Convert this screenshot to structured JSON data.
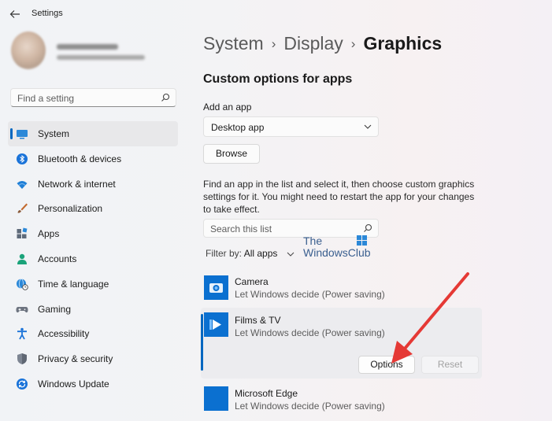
{
  "window": {
    "title": "Settings"
  },
  "search": {
    "placeholder": "Find a setting"
  },
  "sidebar": {
    "items": [
      {
        "label": "System",
        "icon": "system-icon",
        "selected": true
      },
      {
        "label": "Bluetooth & devices",
        "icon": "bluetooth-icon"
      },
      {
        "label": "Network & internet",
        "icon": "wifi-icon"
      },
      {
        "label": "Personalization",
        "icon": "brush-icon"
      },
      {
        "label": "Apps",
        "icon": "apps-icon"
      },
      {
        "label": "Accounts",
        "icon": "person-icon"
      },
      {
        "label": "Time & language",
        "icon": "globe-clock-icon"
      },
      {
        "label": "Gaming",
        "icon": "gamepad-icon"
      },
      {
        "label": "Accessibility",
        "icon": "accessibility-icon"
      },
      {
        "label": "Privacy & security",
        "icon": "shield-icon"
      },
      {
        "label": "Windows Update",
        "icon": "update-icon"
      }
    ]
  },
  "breadcrumb": {
    "items": [
      "System",
      "Display",
      "Graphics"
    ],
    "separator": "›"
  },
  "main": {
    "section_title": "Custom options for apps",
    "add_app_label": "Add an app",
    "app_type_select": {
      "value": "Desktop app"
    },
    "browse_label": "Browse",
    "info_text": "Find an app in the list and select it, then choose custom graphics settings for it. You might need to restart the app for your changes to take effect.",
    "list_search_placeholder": "Search this list",
    "filter": {
      "label": "Filter by:",
      "value": "All apps"
    },
    "apps": [
      {
        "name": "Camera",
        "desc": "Let Windows decide (Power saving)"
      },
      {
        "name": "Films & TV",
        "desc": "Let Windows decide (Power saving)"
      },
      {
        "name": "Microsoft Edge",
        "desc": "Let Windows decide (Power saving)"
      }
    ],
    "options_label": "Options",
    "reset_label": "Reset"
  },
  "watermark": {
    "line1": "The",
    "line2": "WindowsClub"
  },
  "colors": {
    "accent": "#0067c0",
    "app_tile": "#0b70d0",
    "annotation_arrow": "#e53935"
  }
}
